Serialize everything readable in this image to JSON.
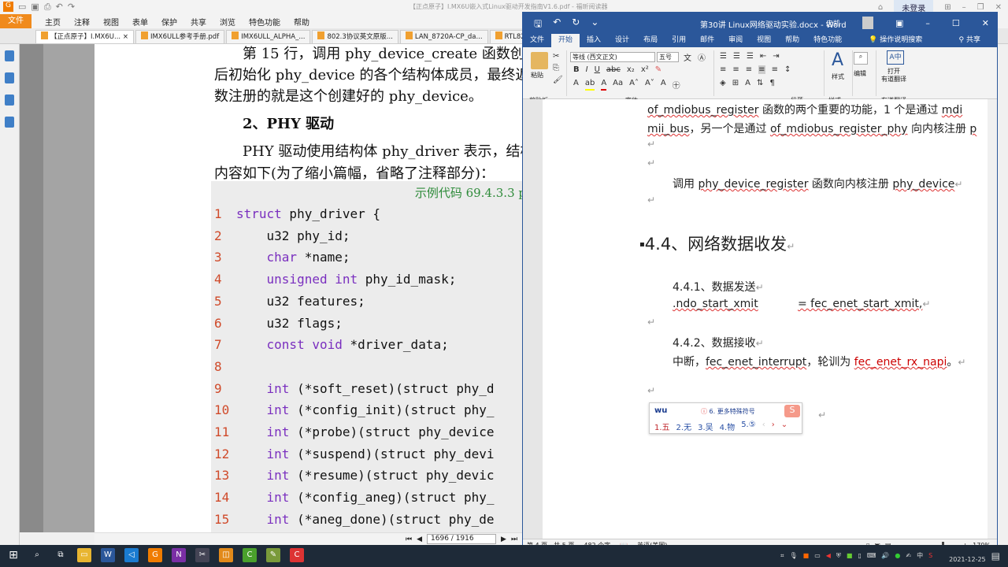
{
  "pdf": {
    "window_title": "【正点原子】I.MX6U嵌入式Linux驱动开发指南V1.6.pdf - 福昕阅读器",
    "login": "未登录",
    "file_menu": "文件",
    "menu": [
      "主页",
      "注释",
      "视图",
      "表单",
      "保护",
      "共享",
      "浏览",
      "特色功能",
      "帮助"
    ],
    "tabs": [
      "【正点原子】I.MX6U...",
      "IMX6ULL参考手册.pdf",
      "IMX6ULL_ALPHA_...",
      "802.3协议英文原版...",
      "LAN_8720A-CP_da...",
      "RTL8211F-CG.pdf"
    ],
    "close_tab": "×",
    "content": {
      "p1": "第 15 行，调用 phy_device_create 函数创建 p",
      "p2": "后初始化 phy_device 的各个结构体成员，最终返",
      "p3": "数注册的就是这个创建好的 phy_device。",
      "heading": "2、PHY 驱动",
      "p4": "PHY 驱动使用结构体 phy_driver 表示，结构",
      "p5": "内容如下(为了缩小篇幅，省略了注释部分)：",
      "code_caption": "示例代码 69.4.3.3 p",
      "code": [
        {
          "n": "1",
          "k": "struct",
          "t": " phy_driver {",
          "i": ""
        },
        {
          "n": "2",
          "k": "",
          "t": "u32 phy_id;",
          "i": "    "
        },
        {
          "n": "3",
          "k": "char",
          "t": " *name;",
          "i": "    "
        },
        {
          "n": "4",
          "k": "unsigned int",
          "t": " phy_id_mask;",
          "i": "    "
        },
        {
          "n": "5",
          "k": "",
          "t": "u32 features;",
          "i": "    "
        },
        {
          "n": "6",
          "k": "",
          "t": "u32 flags;",
          "i": "    "
        },
        {
          "n": "7",
          "k": "const void",
          "t": " *driver_data;",
          "i": "    "
        },
        {
          "n": "8",
          "k": "",
          "t": "",
          "i": ""
        },
        {
          "n": "9",
          "k": "int",
          "t": " (*soft_reset)(struct phy_d",
          "i": "    "
        },
        {
          "n": "10",
          "k": "int",
          "t": " (*config_init)(struct phy_",
          "i": "    "
        },
        {
          "n": "11",
          "k": "int",
          "t": " (*probe)(struct phy_device",
          "i": "    "
        },
        {
          "n": "12",
          "k": "int",
          "t": " (*suspend)(struct phy_devi",
          "i": "    "
        },
        {
          "n": "13",
          "k": "int",
          "t": " (*resume)(struct phy_devic",
          "i": "    "
        },
        {
          "n": "14",
          "k": "int",
          "t": " (*config_aneg)(struct phy_",
          "i": "    "
        },
        {
          "n": "15",
          "k": "int",
          "t": " (*aneg_done)(struct phy_de",
          "i": "    "
        }
      ]
    },
    "page_indicator": "1696 / 1916"
  },
  "word": {
    "title": "第30讲 Linux网络驱动实验.docx - Word",
    "user": "忠凯",
    "tabs": [
      "文件",
      "开始",
      "插入",
      "设计",
      "布局",
      "引用",
      "邮件",
      "审阅",
      "视图",
      "帮助",
      "特色功能"
    ],
    "active_tab": "开始",
    "search": "操作说明搜索",
    "share": "共享",
    "ribbon": {
      "paste": "粘贴",
      "clipboard": "剪贴板",
      "font_name": "等线 (西文正文)",
      "font_size": "五号",
      "font_group": "字体",
      "paragraph_group": "段落",
      "styles": "样式",
      "styles_group": "样式",
      "edit": "编辑",
      "translate": "打开\n有道翻译",
      "translate_group": "有道翻译"
    },
    "doc": {
      "l1a": "of_mdiobus_register",
      "l1b": " 函数的两个重要的功能，1 个是通过 ",
      "l1c": "mdi",
      "l2a": "mii_bus",
      "l2b": "，另一个是通过 ",
      "l2c": "of_mdiobus_register_phy",
      "l2d": " 向内核注册 ",
      "l2e": "p",
      "l3a": "调用 ",
      "l3b": "phy_device_register",
      "l3c": " 函数向内核注册 ",
      "l3d": "phy_device",
      "h": "4.4、网络数据收发",
      "s1": "4.4.1、数据发送",
      "x1": ".ndo_start_xmit",
      "x2": "= fec_enet_start_xmit,",
      "s2": "4.4.2、数据接收",
      "r1": "中断，",
      "r2": "fec_enet_interrupt",
      "r3": "，轮训为 ",
      "r4": "fec_enet_rx_napi",
      "r5": "。",
      "ret": "↵"
    },
    "ime": {
      "input": "wu",
      "hint_num": "ⓘ",
      "hint": "6. 更多特殊符号",
      "candidates": [
        "1.五",
        "2.无",
        "3.吴",
        "4.物",
        "5.⑤"
      ]
    },
    "status": {
      "page": "第 4 页，共 5 页",
      "words": "482 个字",
      "lang": "英语(美国)",
      "zoom": "170%"
    }
  },
  "taskbar": {
    "date": "2021-12-25",
    "ime_lang": "中"
  }
}
